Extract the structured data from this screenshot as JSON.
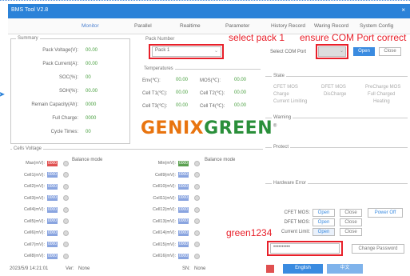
{
  "window": {
    "title": "BMS Tool V2.8",
    "close_glyph": "×"
  },
  "menu": [
    "Monitor",
    "Parallel",
    "Realtime",
    "Parameter",
    "History Record",
    "Waring Record",
    "System Config"
  ],
  "summary": {
    "title": "Summary",
    "rows": [
      {
        "label": "Pack Voltage(V):",
        "value": "00.00"
      },
      {
        "label": "Pack Current(A):",
        "value": "00.00"
      },
      {
        "label": "SOC(%):",
        "value": "00"
      },
      {
        "label": "SOH(%):",
        "value": "00.00"
      },
      {
        "label": "Remain Capacity(Ah):",
        "value": "0000"
      },
      {
        "label": "Full Charge:",
        "value": "0000"
      },
      {
        "label": "Cycle Times:",
        "value": "00"
      }
    ]
  },
  "pack": {
    "title": "Pack Number",
    "selected": "Pack 1"
  },
  "temperatures": {
    "title": "Temperatures",
    "rows": [
      [
        {
          "label": "Env(℃):",
          "value": "00.00"
        },
        {
          "label": "MOS(℃):",
          "value": "00.00"
        }
      ],
      [
        {
          "label": "Cell T1(℃):",
          "value": "00.00"
        },
        {
          "label": "Cell T2(℃):",
          "value": "00.00"
        }
      ],
      [
        {
          "label": "Cell T3(℃):",
          "value": "00.00"
        },
        {
          "label": "Cell T4(℃):",
          "value": "00.00"
        }
      ]
    ]
  },
  "logo": {
    "part1": "GENIX",
    "part2": "GREEN",
    "mark": "®"
  },
  "com": {
    "label": "Select COM Port",
    "value": "",
    "open": "Open",
    "close": "Close"
  },
  "state": {
    "title": "State",
    "items": [
      "CFET MOS",
      "DFET MOS",
      "PreCharge MOS",
      "Charge",
      "DisCharge",
      "Full Charged",
      "Current Limiting",
      "Heating"
    ]
  },
  "warning": {
    "title": "Warning"
  },
  "protect": {
    "title": "Protect"
  },
  "hardware": {
    "title": "Hardware Error"
  },
  "controls": [
    {
      "label": "CFET MOS:",
      "open": "Open",
      "close": "Close"
    },
    {
      "label": "DFET MOS:",
      "open": "Open",
      "close": "Close"
    },
    {
      "label": "Current Limit:",
      "open": "Open",
      "close": "Close"
    }
  ],
  "power_off": "Power Off",
  "password": {
    "value": "••••••••••",
    "change": "Change Password"
  },
  "annotations": {
    "select_pack": "select pack 1",
    "ensure_com": "ensure COM Port correct",
    "password_hint": "green1234"
  },
  "cells": {
    "title": "Cells Voltage",
    "balance_mode": "Balance mode",
    "left": [
      {
        "label": "Max(mV):",
        "value": "0000",
        "color": "#e05050"
      },
      {
        "label": "Cell1(mV):",
        "value": "0000"
      },
      {
        "label": "Cell2(mV):",
        "value": "0000"
      },
      {
        "label": "Cell3(mV):",
        "value": "0000"
      },
      {
        "label": "Cell4(mV):",
        "value": "0000"
      },
      {
        "label": "Cell5(mV):",
        "value": "0000"
      },
      {
        "label": "Cell6(mV):",
        "value": "0000"
      },
      {
        "label": "Cell7(mV):",
        "value": "0000"
      },
      {
        "label": "Cell8(mV):",
        "value": "0000"
      }
    ],
    "right": [
      {
        "label": "Min(mV):",
        "value": "0000",
        "color": "#5aa050"
      },
      {
        "label": "Cell9(mV):",
        "value": "0000"
      },
      {
        "label": "Cell10(mV):",
        "value": "0000"
      },
      {
        "label": "Cell11(mV):",
        "value": "0000"
      },
      {
        "label": "Cell12(mV):",
        "value": "0000"
      },
      {
        "label": "Cell13(mV):",
        "value": "0000"
      },
      {
        "label": "Cell14(mV):",
        "value": "0000"
      },
      {
        "label": "Cell15(mV):",
        "value": "0000"
      },
      {
        "label": "Cell16(mV):",
        "value": "0000"
      }
    ]
  },
  "status": {
    "datetime": "2023/5/9 14:21:01",
    "ver_label": "Ver:",
    "ver": "None",
    "sn_label": "SN:",
    "sn": "None"
  },
  "lang": {
    "english": "English",
    "chinese": "中文"
  },
  "colors": {
    "accent": "#2b82d8",
    "annotation": "#e8202a",
    "value_green": "#4aa040"
  }
}
